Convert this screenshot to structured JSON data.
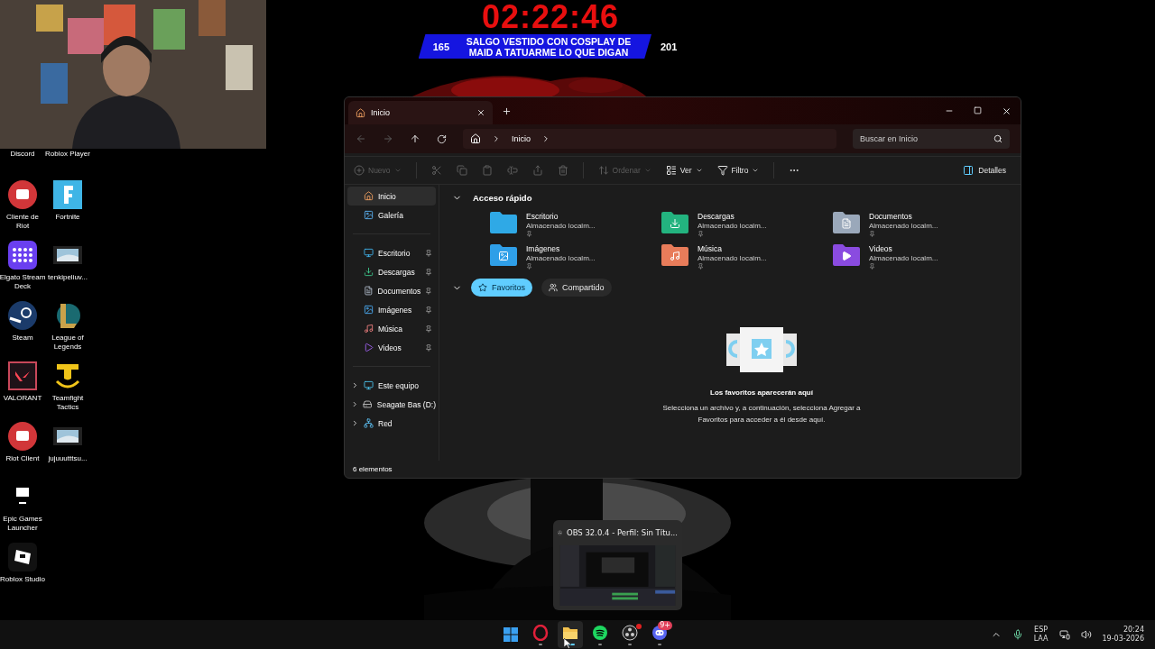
{
  "stream_overlay": {
    "timer": "02:22:46",
    "left_count": "165",
    "message": "SALGO VESTIDO CON COSPLAY DE MAID A TATUARME LO QUE DIGAN",
    "right_count": "201"
  },
  "desktop_icons": [
    {
      "label": "Discord",
      "kind": "hidden"
    },
    {
      "label": "Cliente de Riot",
      "kind": "riot"
    },
    {
      "label": "Elgato Stream Deck",
      "kind": "elgato"
    },
    {
      "label": "Steam",
      "kind": "steam"
    },
    {
      "label": "VALORANT",
      "kind": "valorant"
    },
    {
      "label": "Riot Client",
      "kind": "riot"
    },
    {
      "label": "Epic Games Launcher",
      "kind": "epic"
    },
    {
      "label": "Roblox Studio",
      "kind": "roblox"
    },
    {
      "label": "Roblox Player",
      "kind": "hidden"
    },
    {
      "label": "Fortnite",
      "kind": "fortnite"
    },
    {
      "label": "tenkipeliuv...",
      "kind": "video"
    },
    {
      "label": "League of Legends",
      "kind": "lol"
    },
    {
      "label": "Teamfight Tactics",
      "kind": "tft"
    },
    {
      "label": "jujuuutttsu...",
      "kind": "video"
    }
  ],
  "explorer": {
    "tabs": [
      {
        "label": "Inicio",
        "selected": true
      }
    ],
    "address": [
      "Inicio"
    ],
    "search": {
      "placeholder": "Buscar en Inicio"
    },
    "toolbar": [
      {
        "kind": "new",
        "label": "Nuevo",
        "disabled": true
      },
      {
        "kind": "cut",
        "disabled": true
      },
      {
        "kind": "copy",
        "disabled": true
      },
      {
        "kind": "paste",
        "disabled": true
      },
      {
        "kind": "rename",
        "disabled": true
      },
      {
        "kind": "share",
        "disabled": true
      },
      {
        "kind": "delete",
        "disabled": true
      },
      {
        "kind": "sort",
        "label": "Ordenar",
        "disabled": true
      },
      {
        "kind": "view",
        "label": "Ver",
        "disabled": false
      },
      {
        "kind": "filter",
        "label": "Filtro",
        "disabled": false
      },
      {
        "kind": "more",
        "disabled": false
      }
    ],
    "details_button": "Detalles",
    "sidebar": {
      "top": [
        {
          "label": "Inicio",
          "kind": "home",
          "selected": true
        },
        {
          "label": "Galería",
          "kind": "gallery",
          "selected": false
        }
      ],
      "pinned": [
        {
          "label": "Escritorio",
          "kind": "desktop",
          "pinned": true
        },
        {
          "label": "Descargas",
          "kind": "downloads",
          "pinned": true
        },
        {
          "label": "Documentos",
          "kind": "documents",
          "pinned": true
        },
        {
          "label": "Imágenes",
          "kind": "pictures",
          "pinned": true
        },
        {
          "label": "Música",
          "kind": "music",
          "pinned": true
        },
        {
          "label": "Videos",
          "kind": "videos",
          "pinned": true
        }
      ],
      "locations": [
        {
          "label": "Este equipo",
          "kind": "pc",
          "expanded": false
        },
        {
          "label": "Seagate Bas (D:)",
          "kind": "drive",
          "expanded": false
        },
        {
          "label": "Red",
          "kind": "network",
          "expanded": false
        }
      ]
    },
    "quick_access": {
      "title": "Acceso rápido",
      "expanded": true,
      "items": [
        {
          "name": "Escritorio",
          "subtitle": "Almacenado localm...",
          "kind": "desktop",
          "pinned": true
        },
        {
          "name": "Descargas",
          "subtitle": "Almacenado localm...",
          "kind": "downloads",
          "pinned": true
        },
        {
          "name": "Documentos",
          "subtitle": "Almacenado localm...",
          "kind": "documents",
          "pinned": true
        },
        {
          "name": "Imágenes",
          "subtitle": "Almacenado localm...",
          "kind": "pictures",
          "pinned": true
        },
        {
          "name": "Música",
          "subtitle": "Almacenado localm...",
          "kind": "music",
          "pinned": true
        },
        {
          "name": "Videos",
          "subtitle": "Almacenado localm...",
          "kind": "videos",
          "pinned": true
        }
      ]
    },
    "filter_tabs": [
      {
        "label": "Favoritos",
        "kind": "star",
        "selected": true
      },
      {
        "label": "Compartido",
        "kind": "people",
        "selected": false
      }
    ],
    "empty_state": {
      "title": "Los favoritos aparecerán aquí",
      "text": "Selecciona un archivo y, a continuación, selecciona Agregar a Favoritos para acceder a él desde aquí."
    },
    "status_bar": "6 elementos"
  },
  "obs_preview": {
    "title": "OBS 32.0.4 - Perfil: Sin Títu..."
  },
  "taskbar": {
    "apps": [
      {
        "kind": "start",
        "running": false,
        "selected": false,
        "alert": false
      },
      {
        "kind": "opera",
        "running": true,
        "selected": false,
        "alert": false
      },
      {
        "kind": "explorer",
        "running": true,
        "selected": true,
        "alert": false
      },
      {
        "kind": "spotify",
        "running": true,
        "selected": false,
        "alert": false
      },
      {
        "kind": "obs",
        "running": true,
        "selected": false,
        "alert": true
      },
      {
        "kind": "discord",
        "running": true,
        "selected": false,
        "alert": false,
        "badge": "9+"
      }
    ],
    "language": "ESP",
    "layout": "LAA",
    "time": "20:24",
    "date": "19-03-2026"
  }
}
